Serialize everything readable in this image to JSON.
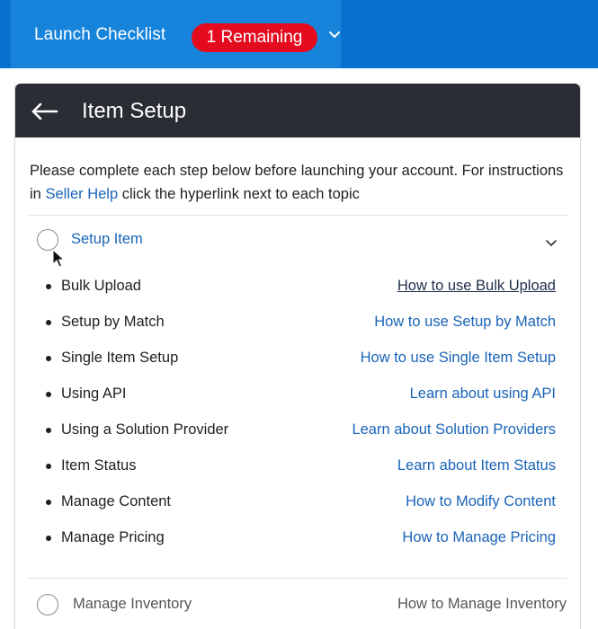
{
  "topbar": {
    "title": "Launch Checklist",
    "badge": "1 Remaining"
  },
  "panel": {
    "title": "Item Setup",
    "intro": {
      "text_before_link": "Please complete each step below before launching your account. For instructions in ",
      "link_text": "Seller Help",
      "text_after_link": " click the hyperlink next to each topic"
    },
    "section": {
      "label": "Setup Item",
      "items": [
        {
          "label": "Bulk Upload",
          "link": "How to use Bulk Upload"
        },
        {
          "label": "Setup by Match",
          "link": "How to use Setup by Match"
        },
        {
          "label": "Single Item Setup",
          "link": "How to use Single Item Setup"
        },
        {
          "label": "Using API",
          "link": "Learn about using API"
        },
        {
          "label": "Using a Solution Provider",
          "link": "Learn about Solution Providers"
        },
        {
          "label": "Item Status",
          "link": "Learn about Item Status"
        },
        {
          "label": "Manage Content",
          "link": "How to Modify Content"
        },
        {
          "label": "Manage Pricing",
          "link": "How to Manage Pricing"
        }
      ]
    },
    "next_section": {
      "label": "Manage Inventory",
      "link": "How to Manage Inventory"
    }
  },
  "colors": {
    "topbar": "#0a71d0",
    "topbar_tab": "#1784dc",
    "badge": "#e40b1f",
    "header": "#2a2d34",
    "link": "#1a64b8"
  },
  "icons": {
    "badge_dropdown": "chevron-down-icon",
    "back": "arrow-left-icon",
    "section_toggle": "chevron-down-icon",
    "status": "radio-circle-icon",
    "pointer": "mouse-cursor-icon"
  }
}
